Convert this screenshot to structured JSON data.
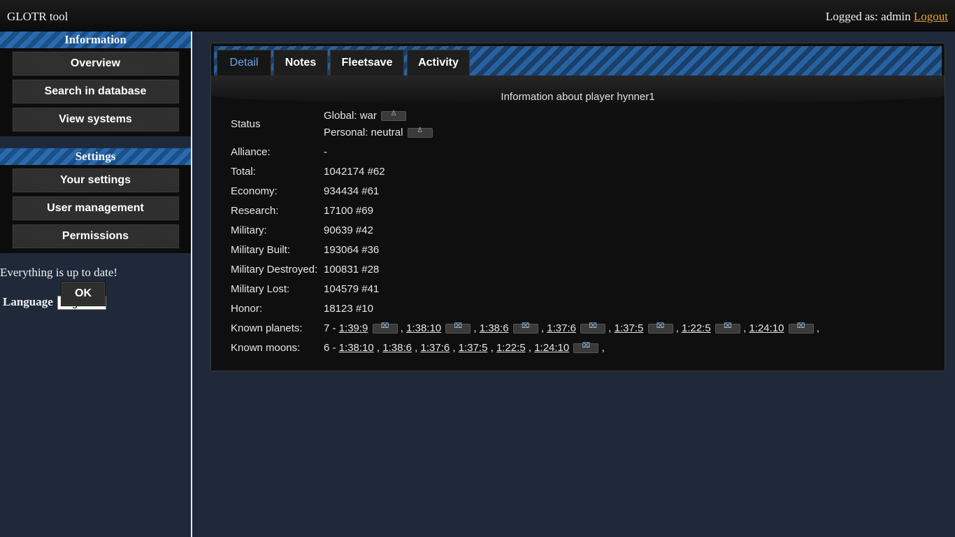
{
  "header": {
    "app_title": "GLOTR tool",
    "logged_as": "Logged as: admin",
    "logout": "Logout"
  },
  "sidebar": {
    "information": {
      "title": "Information",
      "items": [
        "Overview",
        "Search in database",
        "View systems"
      ]
    },
    "settings": {
      "title": "Settings",
      "items": [
        "Your settings",
        "User management",
        "Permissions"
      ]
    },
    "status_text": "Everything is up to date!",
    "language_label": "Language",
    "language_value": "English",
    "ok_button": "OK"
  },
  "tabs": [
    "Detail",
    "Notes",
    "Fleetsave",
    "Activity"
  ],
  "active_tab": "Detail",
  "player": {
    "title": "Information about player hynner1",
    "status_label": "Status",
    "status_global": "Global: war",
    "status_personal": "Personal: neutral",
    "rows": [
      {
        "label": "Alliance:",
        "value": "-"
      },
      {
        "label": "Total:",
        "value": "1042174 #62"
      },
      {
        "label": "Economy:",
        "value": "934434 #61"
      },
      {
        "label": "Research:",
        "value": "17100 #69"
      },
      {
        "label": "Military:",
        "value": "90639 #42"
      },
      {
        "label": "Military Built:",
        "value": "193064 #36"
      },
      {
        "label": "Military Destroyed:",
        "value": "100831 #28"
      },
      {
        "label": "Military Lost:",
        "value": "104579 #41"
      },
      {
        "label": "Honor:",
        "value": "18123 #10"
      }
    ],
    "known_planets_label": "Known planets:",
    "known_planets_count": "7 -",
    "planets": [
      "1:39:9",
      "1:38:10",
      "1:38:6",
      "1:37:6",
      "1:37:5",
      "1:22:5",
      "1:24:10"
    ],
    "known_moons_label": "Known moons:",
    "known_moons_count": "6 -",
    "moons": [
      "1:38:10",
      "1:38:6",
      "1:37:6",
      "1:37:5",
      "1:22:5",
      "1:24:10"
    ]
  }
}
